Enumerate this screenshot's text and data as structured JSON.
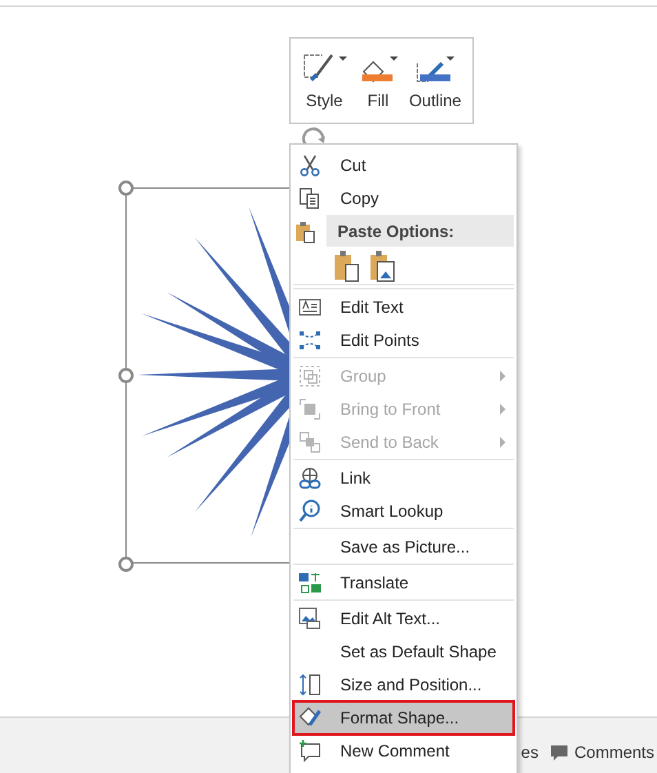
{
  "mini_toolbar": [
    {
      "label": "Style"
    },
    {
      "label": "Fill",
      "color": "#ed7d31"
    },
    {
      "label": "Outline",
      "color": "#4472c4"
    }
  ],
  "context_menu": [
    {
      "kind": "item",
      "label": "Cut",
      "disabled": false,
      "submenu": false,
      "selected": false,
      "separator_before": false
    },
    {
      "kind": "item",
      "label": "Copy",
      "disabled": false,
      "submenu": false,
      "selected": false,
      "separator_before": false
    },
    {
      "kind": "header",
      "label": "Paste Options:"
    },
    {
      "kind": "paste"
    },
    {
      "kind": "item",
      "label": "Edit Text",
      "disabled": false,
      "submenu": false,
      "selected": false,
      "separator_before": true
    },
    {
      "kind": "item",
      "label": "Edit Points",
      "disabled": false,
      "submenu": false,
      "selected": false,
      "separator_before": false
    },
    {
      "kind": "item",
      "label": "Group",
      "disabled": true,
      "submenu": true,
      "selected": false,
      "separator_before": true
    },
    {
      "kind": "item",
      "label": "Bring to Front",
      "disabled": true,
      "submenu": true,
      "selected": false,
      "separator_before": false
    },
    {
      "kind": "item",
      "label": "Send to Back",
      "disabled": true,
      "submenu": true,
      "selected": false,
      "separator_before": false
    },
    {
      "kind": "item",
      "label": "Link",
      "disabled": false,
      "submenu": false,
      "selected": false,
      "separator_before": true
    },
    {
      "kind": "item",
      "label": "Smart Lookup",
      "disabled": false,
      "submenu": false,
      "selected": false,
      "separator_before": false
    },
    {
      "kind": "item",
      "label": "Save as Picture...",
      "disabled": false,
      "submenu": false,
      "selected": false,
      "separator_before": true
    },
    {
      "kind": "item",
      "label": "Translate",
      "disabled": false,
      "submenu": false,
      "selected": false,
      "separator_before": true
    },
    {
      "kind": "item",
      "label": "Edit Alt Text...",
      "disabled": false,
      "submenu": false,
      "selected": false,
      "separator_before": true
    },
    {
      "kind": "item",
      "label": "Set as Default Shape",
      "disabled": false,
      "submenu": false,
      "selected": false,
      "separator_before": false
    },
    {
      "kind": "item",
      "label": "Size and Position...",
      "disabled": false,
      "submenu": false,
      "selected": false,
      "separator_before": false
    },
    {
      "kind": "item",
      "label": "Format Shape...",
      "disabled": false,
      "submenu": false,
      "selected": true,
      "separator_before": false
    },
    {
      "kind": "item",
      "label": "New Comment",
      "disabled": false,
      "submenu": false,
      "selected": false,
      "separator_before": false
    }
  ],
  "status_bar": {
    "notes_label": "es",
    "comments_label": "Comments"
  }
}
